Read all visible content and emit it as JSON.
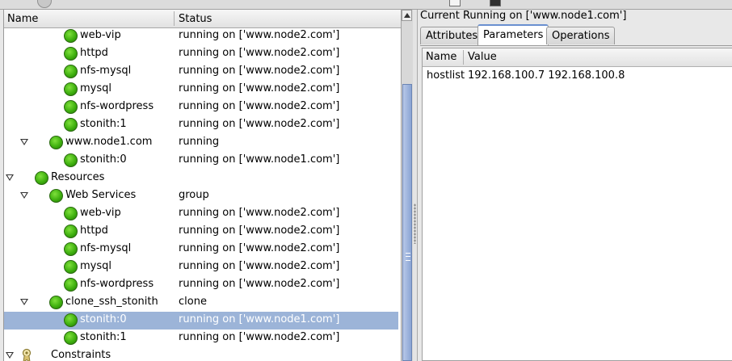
{
  "tree": {
    "columns": {
      "name": "Name",
      "status": "Status"
    },
    "rows": [
      {
        "name": "web-vip",
        "status": "running on ['www.node2.com']",
        "indent": 4,
        "toggle": false,
        "icon": "green-dot"
      },
      {
        "name": "httpd",
        "status": "running on ['www.node2.com']",
        "indent": 4,
        "toggle": false,
        "icon": "green-dot"
      },
      {
        "name": "nfs-mysql",
        "status": "running on ['www.node2.com']",
        "indent": 4,
        "toggle": false,
        "icon": "green-dot"
      },
      {
        "name": "mysql",
        "status": "running on ['www.node2.com']",
        "indent": 4,
        "toggle": false,
        "icon": "green-dot"
      },
      {
        "name": "nfs-wordpress",
        "status": "running on ['www.node2.com']",
        "indent": 4,
        "toggle": false,
        "icon": "green-dot"
      },
      {
        "name": "stonith:1",
        "status": "running on ['www.node2.com']",
        "indent": 4,
        "toggle": false,
        "icon": "green-dot"
      },
      {
        "name": "www.node1.com",
        "status": "running",
        "indent": 3,
        "toggle": true,
        "icon": "green-dot"
      },
      {
        "name": "stonith:0",
        "status": "running on ['www.node1.com']",
        "indent": 4,
        "toggle": false,
        "icon": "green-dot"
      },
      {
        "name": "Resources",
        "status": "",
        "indent": 2,
        "toggle": true,
        "icon": "green-dot"
      },
      {
        "name": "Web Services",
        "status": "group",
        "indent": 3,
        "toggle": true,
        "icon": "green-dot"
      },
      {
        "name": "web-vip",
        "status": "running on ['www.node2.com']",
        "indent": 4,
        "toggle": false,
        "icon": "green-dot"
      },
      {
        "name": "httpd",
        "status": "running on ['www.node2.com']",
        "indent": 4,
        "toggle": false,
        "icon": "green-dot"
      },
      {
        "name": "nfs-mysql",
        "status": "running on ['www.node2.com']",
        "indent": 4,
        "toggle": false,
        "icon": "green-dot"
      },
      {
        "name": "mysql",
        "status": "running on ['www.node2.com']",
        "indent": 4,
        "toggle": false,
        "icon": "green-dot"
      },
      {
        "name": "nfs-wordpress",
        "status": "running on ['www.node2.com']",
        "indent": 4,
        "toggle": false,
        "icon": "green-dot"
      },
      {
        "name": "clone_ssh_stonith",
        "status": "clone",
        "indent": 3,
        "toggle": true,
        "icon": "green-dot"
      },
      {
        "name": "stonith:0",
        "status": "running on ['www.node1.com']",
        "indent": 4,
        "toggle": false,
        "icon": "green-dot",
        "selected": true
      },
      {
        "name": "stonith:1",
        "status": "running on ['www.node2.com']",
        "indent": 4,
        "toggle": false,
        "icon": "green-dot"
      },
      {
        "name": "Constraints",
        "status": "",
        "indent": 2,
        "toggle": true,
        "icon": "constraint-icon"
      }
    ]
  },
  "detail": {
    "title": "Current Running on ['www.node1.com']",
    "tabs": [
      {
        "label": "Attributes",
        "active": false
      },
      {
        "label": "Parameters",
        "active": true
      },
      {
        "label": "Operations",
        "active": false
      }
    ],
    "params": {
      "columns": {
        "name": "Name",
        "value": "Value"
      },
      "rows": [
        {
          "name": "hostlist",
          "value": "192.168.100.7 192.168.100.8"
        }
      ]
    }
  },
  "colors": {
    "selection": "#9cb4d8",
    "status_ok": "#3fb00f",
    "tab_accent": "#6a90d0"
  }
}
